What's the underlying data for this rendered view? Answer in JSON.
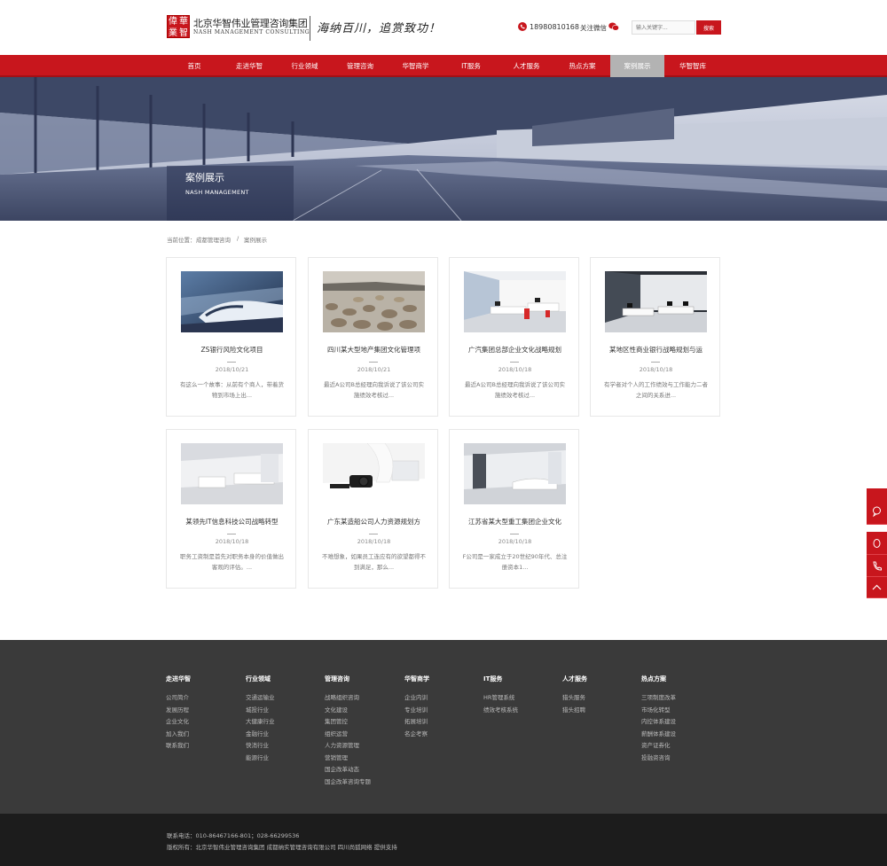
{
  "header": {
    "logo_chars": [
      "偉",
      "華",
      "業",
      "智"
    ],
    "company_name": "北京华智伟业管理咨询集团",
    "company_en": "NASH MANAGEMENT CONSULTING",
    "slogan": "海纳百川，追赏致功！",
    "phone": "18980810168",
    "wechat_label": "关注微信",
    "search": {
      "placeholder": "输入关键字...",
      "button": "搜索"
    }
  },
  "nav": [
    "首页",
    "走进华智",
    "行业领域",
    "管理咨询",
    "华智商学",
    "IT服务",
    "人才服务",
    "热点方案",
    "案例展示",
    "华智智库"
  ],
  "nav_active": "案例展示",
  "banner": {
    "title": "案例展示",
    "subtitle": "NASH MANAGEMENT"
  },
  "breadcrumb": {
    "prefix": "当前位置：",
    "home": "成都管理咨询",
    "sep": "/",
    "current": "案例展示"
  },
  "cases": [
    {
      "title": "ZS银行风险文化项目",
      "date": "2018/10/21",
      "summary": "有这么一个故事：从前有个商人，带着货物到市场上出..."
    },
    {
      "title": "四川某大型地产集团文化管理项",
      "date": "2018/10/21",
      "summary": "最近A公司B总经理向我诉说了该公司实施绩效考核过..."
    },
    {
      "title": "广汽集团总部企业文化战略规划",
      "date": "2018/10/18",
      "summary": "最近A公司B总经理向我诉说了该公司实施绩效考核过..."
    },
    {
      "title": "某地区性商业银行战略规划与运",
      "date": "2018/10/18",
      "summary": "有学者对个人的工作绩效与工作能力二者之间的关系进..."
    },
    {
      "title": "某领先IT信息科技公司战略转型",
      "date": "2018/10/18",
      "summary": "职务工资制是首先对职务本身的价值做出客观的评估。..."
    },
    {
      "title": "广东某造船公司人力资源规划方",
      "date": "2018/10/18",
      "summary": "不难想象，如果员工连应有的欲望都得不到满足，那么..."
    },
    {
      "title": "江苏省某大型重工集团企业文化",
      "date": "2018/10/18",
      "summary": "F公司是一家成立于20世纪90年代、总注册资本1..."
    }
  ],
  "side_icons": [
    "chat-icon",
    "qq-icon",
    "phone-icon",
    "top-arrow-icon"
  ],
  "footer": {
    "columns": [
      {
        "title": "走进华智",
        "links": [
          "公司简介",
          "发展历程",
          "企业文化",
          "加入我们",
          "联系我们"
        ]
      },
      {
        "title": "行业领域",
        "links": [
          "交通运输业",
          "城投行业",
          "大健康行业",
          "金融行业",
          "快消行业",
          "能源行业"
        ]
      },
      {
        "title": "管理咨询",
        "links": [
          "战略组织咨询",
          "文化建设",
          "集团管控",
          "组织运营",
          "人力资源管理",
          "营销管理",
          "国企改革动态",
          "国企改革咨询专题"
        ]
      },
      {
        "title": "华智商学",
        "links": [
          "企业内训",
          "专业培训",
          "拓展培训",
          "名企考察"
        ]
      },
      {
        "title": "IT服务",
        "links": [
          "HR管理系统",
          "绩效考核系统"
        ]
      },
      {
        "title": "人才服务",
        "links": [
          "猎头服务",
          "猎头招聘"
        ]
      },
      {
        "title": "热点方案",
        "links": [
          "三项制度改革",
          "市场化转型",
          "内控体系建设",
          "薪酬体系建设",
          "资产证券化",
          "投融资咨询"
        ]
      }
    ],
    "contact": "联系电话：010-86467166-801；028-66299536",
    "copyright": "版权所有：北京华智伟业管理咨询集团 成都纳实管理咨询有限公司   四川尚狐网络 提供支持"
  },
  "colors": {
    "brand_red": "#c8161d",
    "footer_dark": "#3a3a3a",
    "bottom_dark": "#1c1c1c"
  }
}
